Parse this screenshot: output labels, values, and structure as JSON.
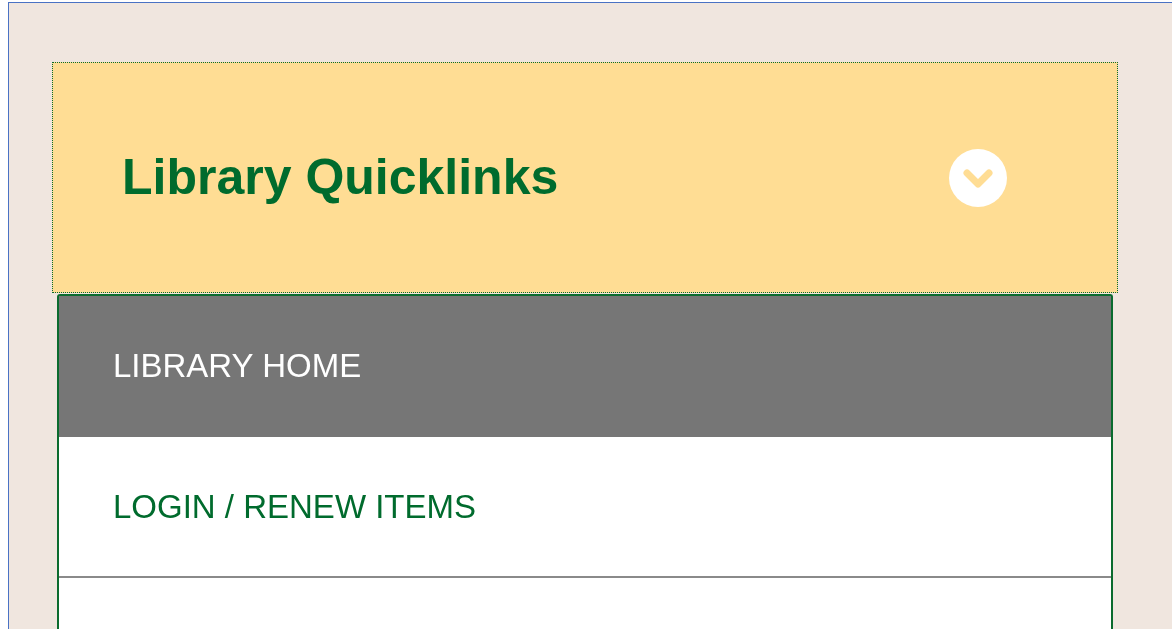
{
  "panel": {
    "title": "Library Quicklinks"
  },
  "links": [
    {
      "label": "LIBRARY HOME",
      "selected": true
    },
    {
      "label": "LOGIN / RENEW ITEMS",
      "selected": false
    }
  ]
}
